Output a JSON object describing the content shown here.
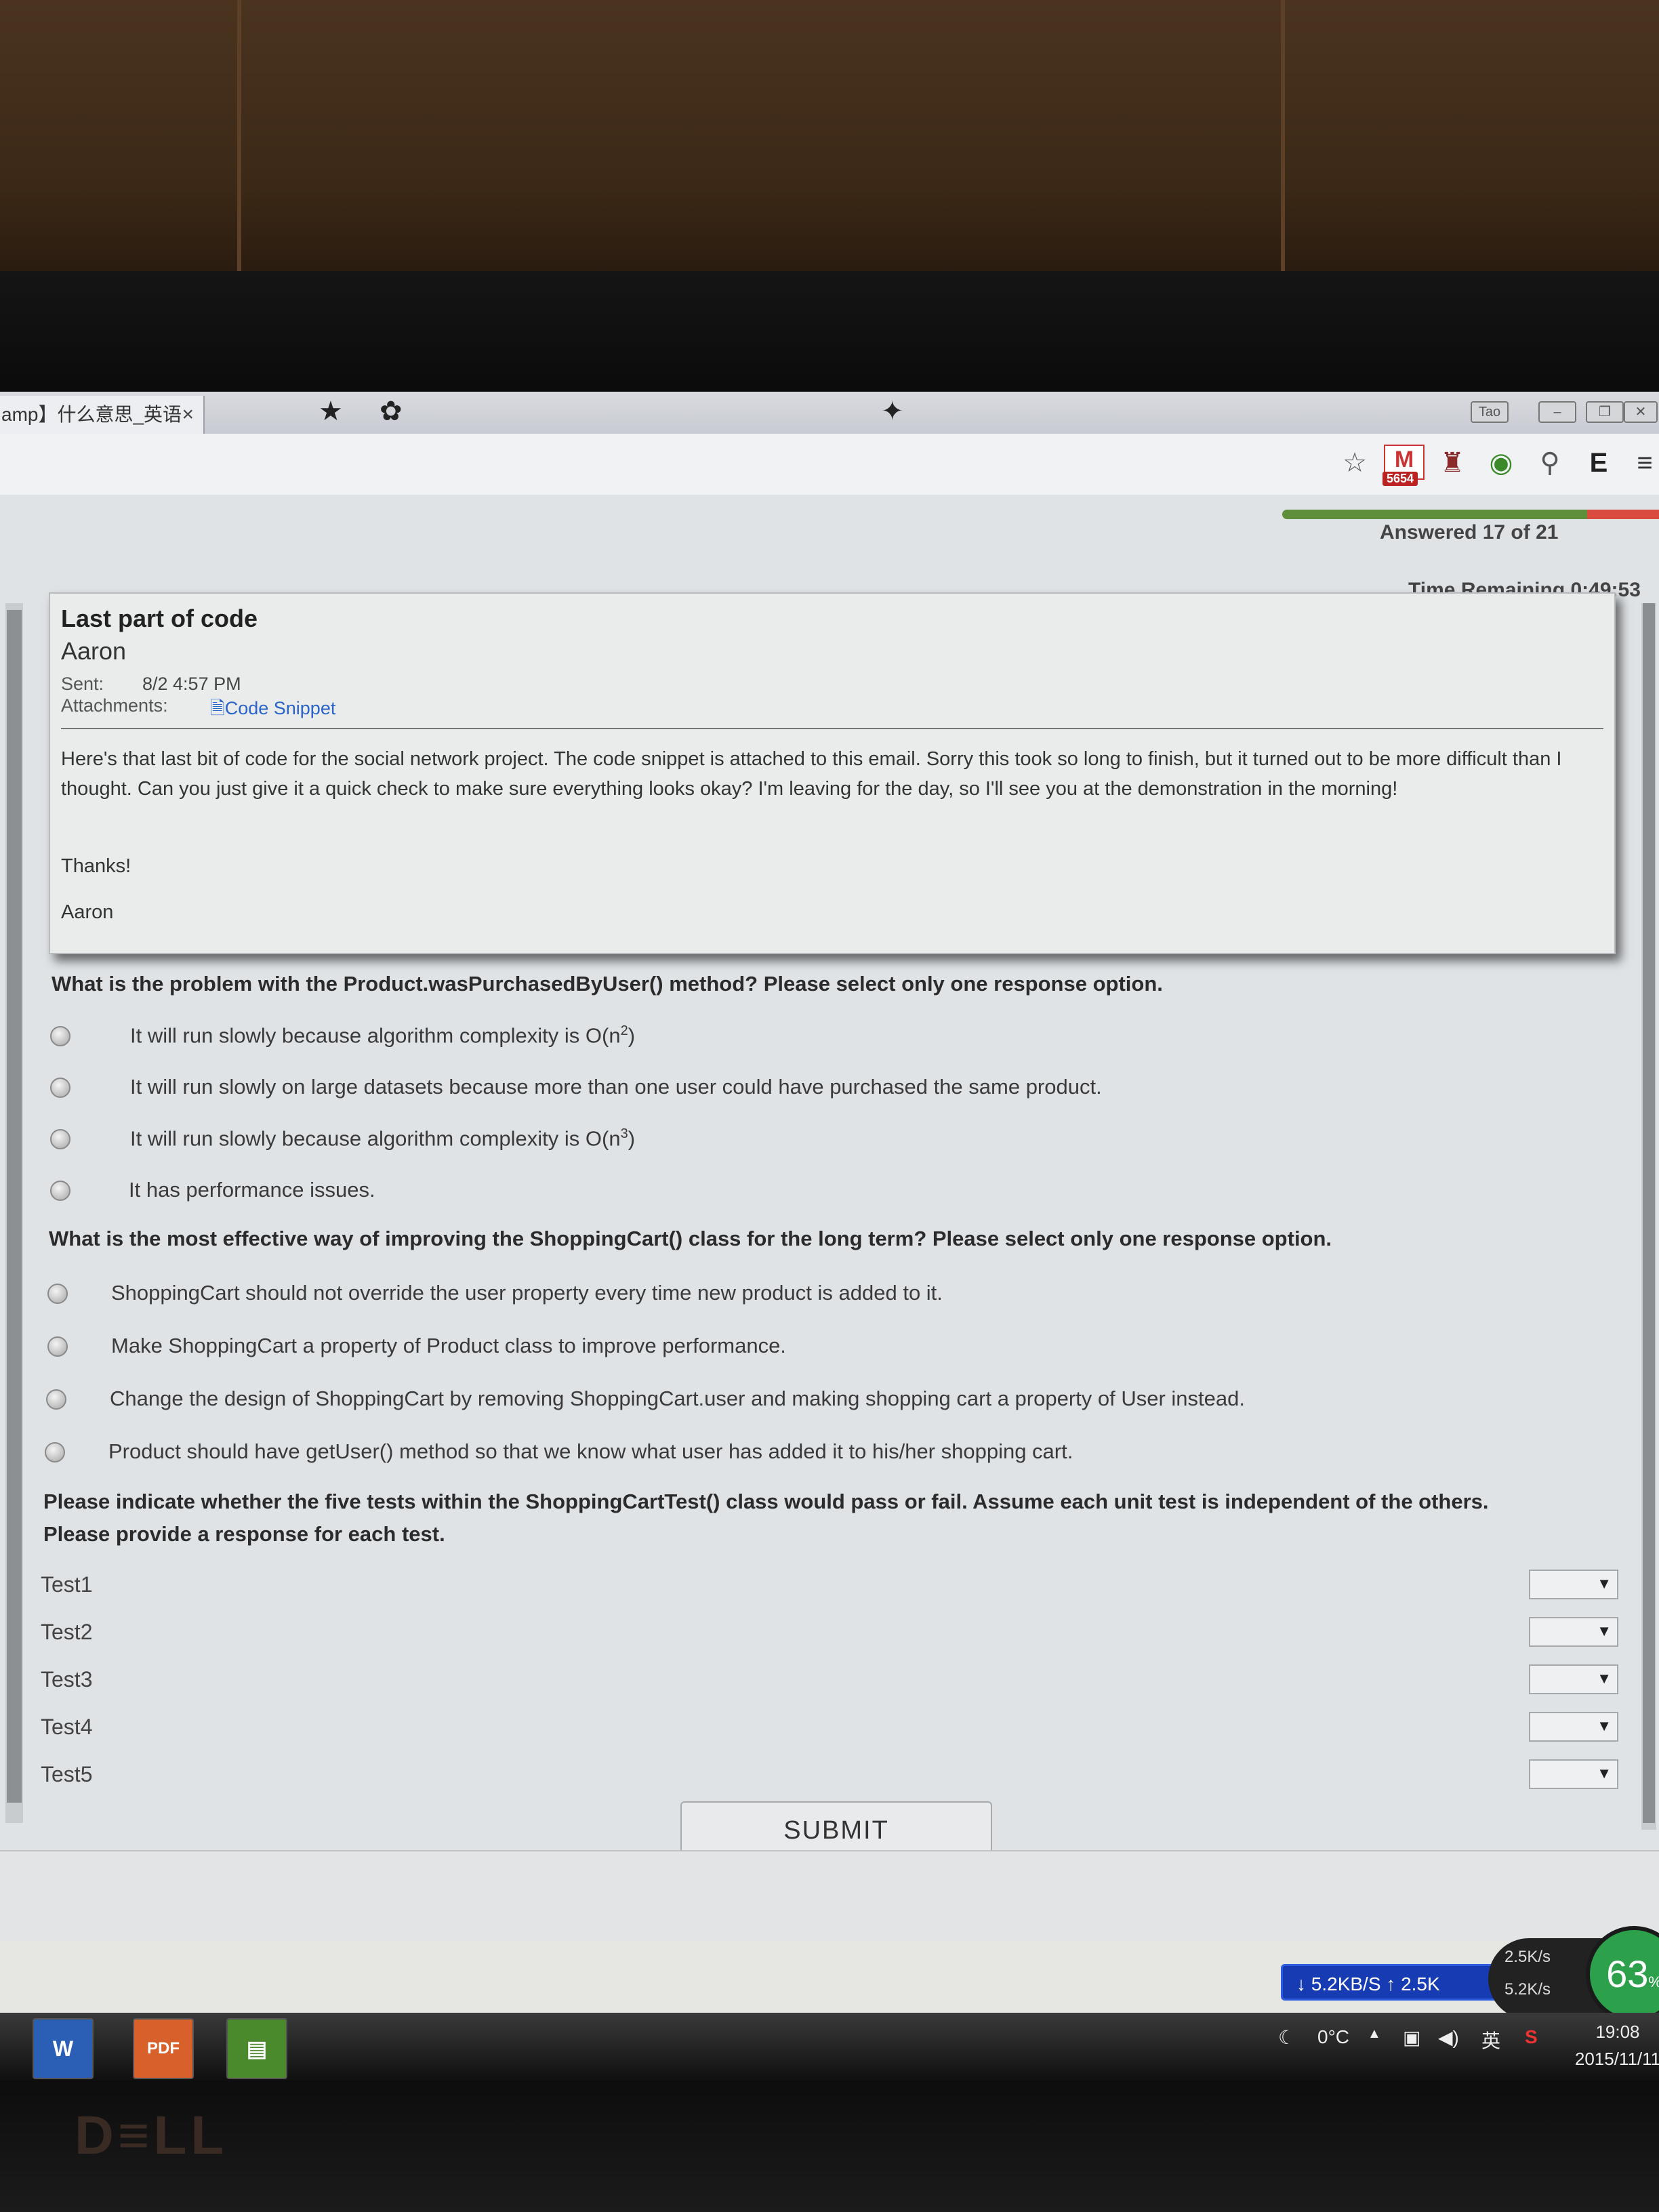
{
  "browser": {
    "tab_title": "amp】什么意思_英语",
    "tab_close": "×",
    "win_btn_label": "Tao"
  },
  "toolbar": {
    "gmail_letter": "M",
    "gmail_count": "5654",
    "menu_glyph": "≡"
  },
  "test": {
    "progress_fraction": 0.81,
    "answered_text": "Answered 17 of 21",
    "time_remaining": "Time Remaining 0:49:53"
  },
  "email": {
    "subject": "Last part of code",
    "sender": "Aaron",
    "sent_label": "Sent:",
    "sent_value": "8/2 4:57 PM",
    "attachments_label": "Attachments:",
    "attachment_name": "Code Snippet",
    "body": [
      "Here's that last bit of code for the social network project. The code snippet is attached to this email. Sorry this took so long to finish, but it turned out to be more difficult than I thought. Can you just give it a quick check to make sure everything looks okay? I'm leaving for the day, so I'll see you at the demonstration in the morning!",
      "Thanks!",
      "Aaron"
    ]
  },
  "q1": {
    "prompt": "What is the problem with the Product.wasPurchasedByUser() method? Please select only one response option.",
    "options": [
      {
        "text": "It will run slowly because algorithm complexity is O(n",
        "sup": "2",
        "tail": ")"
      },
      {
        "text": "It will run slowly on large datasets because more than one user could have purchased the same product.",
        "sup": "",
        "tail": ""
      },
      {
        "text": "It will run slowly because algorithm complexity is O(n",
        "sup": "3",
        "tail": ")"
      },
      {
        "text": "It has performance issues.",
        "sup": "",
        "tail": ""
      }
    ]
  },
  "q2": {
    "prompt": "What is the most effective way of improving the ShoppingCart() class for the long term? Please select only one response option.",
    "options": [
      "ShoppingCart should not override the user property every time new product is added to it.",
      "Make ShoppingCart a property of Product class to improve performance.",
      "Change the design of ShoppingCart by removing ShoppingCart.user and making shopping cart a property of User instead.",
      "Product should have getUser() method so that we know what user has added it to his/her shopping cart."
    ]
  },
  "q3": {
    "prompt_line1": "Please indicate whether the five tests within the ShoppingCartTest() class would pass or fail. Assume each unit test is independent of the others.",
    "prompt_line2": "Please provide a response for each test.",
    "tests": [
      "Test1",
      "Test2",
      "Test3",
      "Test4",
      "Test5"
    ],
    "select_value": ""
  },
  "submit_label": "SUBMIT",
  "network": {
    "down_speed": "5.2KB/S",
    "up_speed": "2.5K",
    "widget_up": "2.5K/s",
    "widget_down": "5.2K/s",
    "gauge_value": "63",
    "gauge_unit": "%"
  },
  "taskbar": {
    "word_label": "W",
    "pdf_label": "PDF",
    "temperature": "0°C",
    "ime": "英",
    "time": "19:08",
    "date": "2015/11/11"
  },
  "colors": {
    "progress_done": "#5f8f3b",
    "progress_rest": "#d94a3f",
    "link": "#2a63c9",
    "gauge": "#2ca04a",
    "net_pill": "#173bb3"
  }
}
